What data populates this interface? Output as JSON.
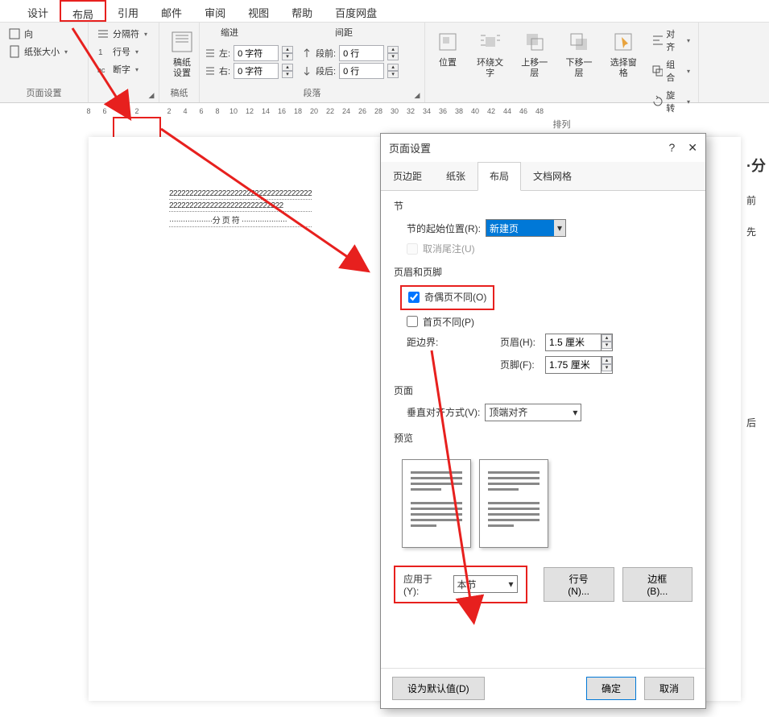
{
  "ribbon": {
    "tabs": [
      "设计",
      "布局",
      "引用",
      "邮件",
      "审阅",
      "视图",
      "帮助",
      "百度网盘"
    ],
    "active_tab": "布局",
    "page_setup": {
      "label": "页面设置",
      "orientation": "向",
      "size": "纸张大小",
      "breaks": "分隔符",
      "line_numbers": "行号",
      "hyphenation": "断字"
    },
    "manuscript": {
      "label": "稿纸",
      "btn": "稿纸\n设置"
    },
    "paragraph": {
      "label": "段落",
      "indent_title": "缩进",
      "spacing_title": "间距",
      "left": "左:",
      "right": "右:",
      "before": "段前:",
      "after": "段后:",
      "left_val": "0 字符",
      "right_val": "0 字符",
      "before_val": "0 行",
      "after_val": "0 行"
    },
    "arrange": {
      "label": "排列",
      "position": "位置",
      "wrap": "环绕文字",
      "forward": "上移一层",
      "backward": "下移一层",
      "selection": "选择窗格",
      "align": "对齐",
      "group": "组合",
      "rotate": "旋转"
    }
  },
  "ruler": {
    "marks": [
      "8",
      "6",
      "4",
      "2",
      "",
      "2",
      "4",
      "6",
      "8",
      "10",
      "12",
      "14",
      "16",
      "18",
      "20",
      "22",
      "24",
      "26",
      "28",
      "30",
      "32",
      "34",
      "36",
      "38",
      "40",
      "42",
      "44",
      "46",
      "48"
    ]
  },
  "document": {
    "l1": "22222222222222222222222222222222222",
    "l2": "2222222222222222222222222222",
    "break": "分页符"
  },
  "sidebar": {
    "t1": "·分",
    "t2": "前",
    "t3": "先",
    "t4": "后"
  },
  "dialog": {
    "title": "页面设置",
    "tabs": [
      "页边距",
      "纸张",
      "布局",
      "文档网格"
    ],
    "active_tab": "布局",
    "section": {
      "title": "节",
      "start_label": "节的起始位置(R):",
      "start_value": "新建页",
      "suppress": "取消尾注(U)"
    },
    "headers": {
      "title": "页眉和页脚",
      "odd_even": "奇偶页不同(O)",
      "first_diff": "首页不同(P)",
      "margin_label": "距边界:",
      "header_label": "页眉(H):",
      "header_val": "1.5 厘米",
      "footer_label": "页脚(F):",
      "footer_val": "1.75 厘米"
    },
    "page": {
      "title": "页面",
      "valign_label": "垂直对齐方式(V):",
      "valign_val": "顶端对齐"
    },
    "preview": {
      "title": "预览"
    },
    "apply": {
      "label": "应用于(Y):",
      "value": "本节",
      "line_numbers": "行号(N)...",
      "borders": "边框(B)..."
    },
    "footer": {
      "default": "设为默认值(D)",
      "ok": "确定",
      "cancel": "取消"
    }
  }
}
